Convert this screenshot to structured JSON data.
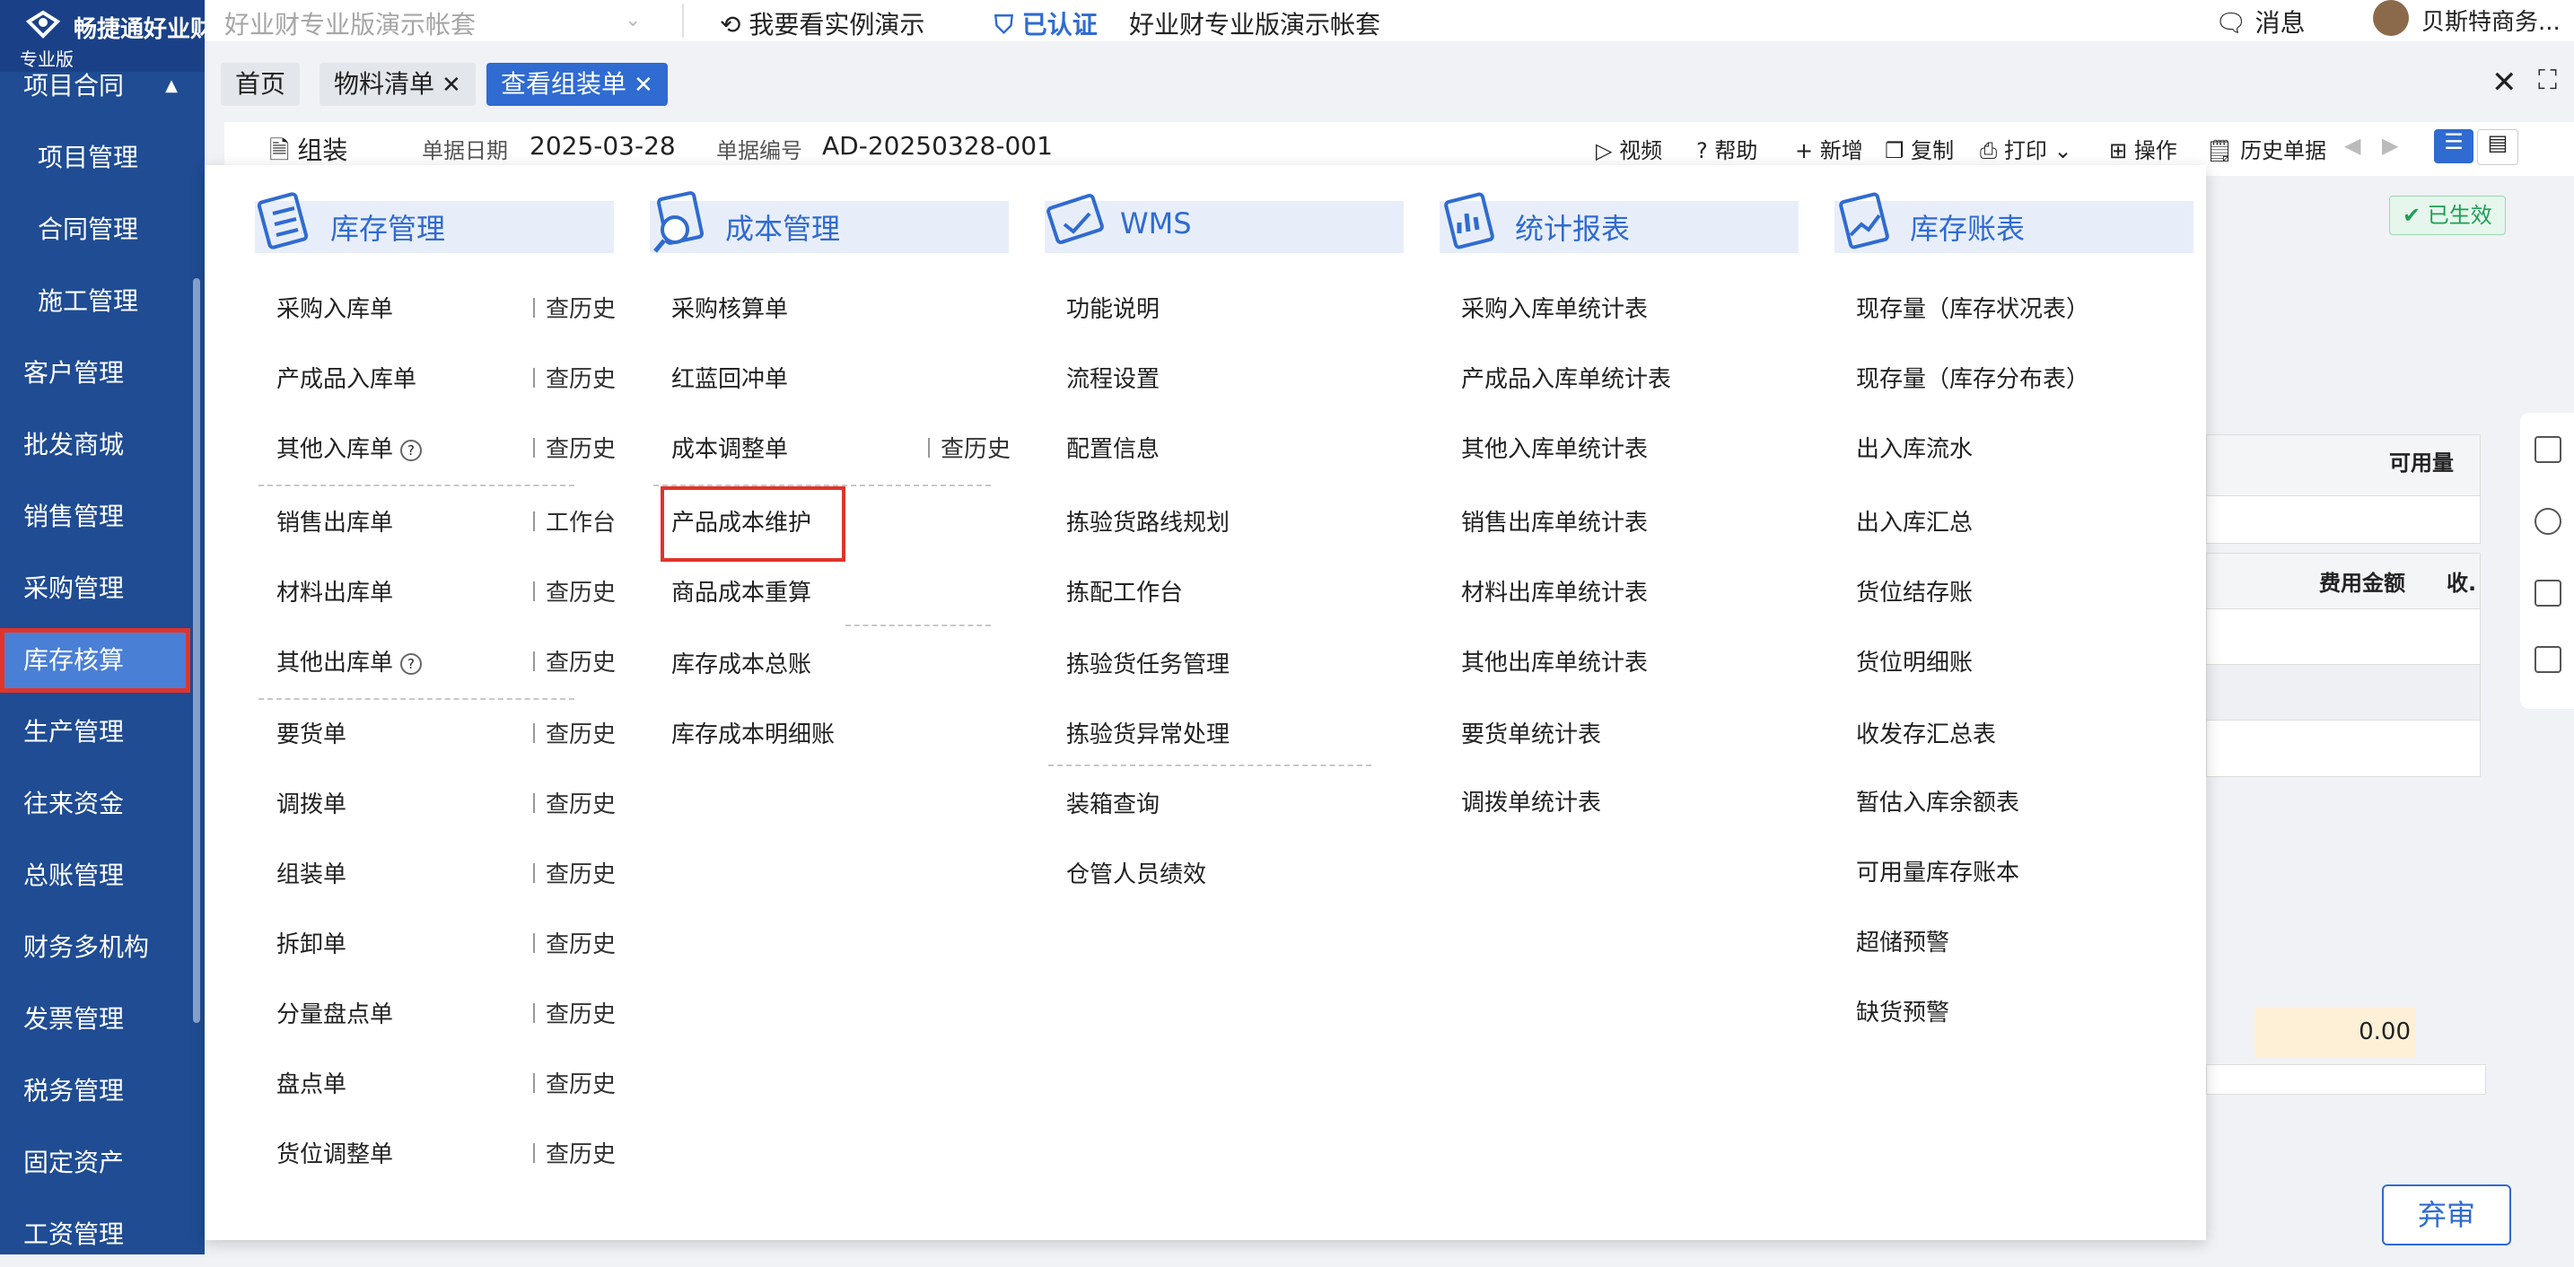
{
  "app": {
    "logo_text": "畅捷通好业财",
    "edition": "专业版"
  },
  "sidebar": {
    "items": [
      {
        "label": "项目合同",
        "kind": "top"
      },
      {
        "label": "项目管理",
        "kind": "sub"
      },
      {
        "label": "合同管理",
        "kind": "sub"
      },
      {
        "label": "施工管理",
        "kind": "sub"
      },
      {
        "label": "客户管理",
        "kind": "top"
      },
      {
        "label": "批发商城",
        "kind": "top"
      },
      {
        "label": "销售管理",
        "kind": "top"
      },
      {
        "label": "采购管理",
        "kind": "top"
      },
      {
        "label": "库存核算",
        "kind": "top",
        "active": true
      },
      {
        "label": "生产管理",
        "kind": "top"
      },
      {
        "label": "往来资金",
        "kind": "top"
      },
      {
        "label": "总账管理",
        "kind": "top"
      },
      {
        "label": "财务多机构",
        "kind": "top"
      },
      {
        "label": "发票管理",
        "kind": "top"
      },
      {
        "label": "税务管理",
        "kind": "top"
      },
      {
        "label": "固定资产",
        "kind": "top"
      },
      {
        "label": "工资管理",
        "kind": "top"
      }
    ]
  },
  "topbar": {
    "account_select": "好业财专业版演示帐套",
    "demo_link": "我要看实例演示",
    "certified": "已认证",
    "account_name": "好业财专业版演示帐套",
    "messages": "消息",
    "user": "贝斯特商务..."
  },
  "tabs": [
    {
      "label": "首页",
      "closable": false
    },
    {
      "label": "物料清单",
      "closable": true
    },
    {
      "label": "查看组装单",
      "closable": true,
      "active": true
    }
  ],
  "toolbar": {
    "doc_type": "组装",
    "date_label": "单据日期",
    "date_value": "2025-03-28",
    "code_label": "单据编号",
    "code_value": "AD-20250328-001",
    "actions": [
      "视频",
      "帮助",
      "新增",
      "复制",
      "打印",
      "操作",
      "历史单据"
    ]
  },
  "background": {
    "status": "已生效",
    "col_available": "可用量",
    "col_fee": "费用金额",
    "col_receipt": "收.",
    "total_amount": "0.00",
    "abandon_button": "弃审"
  },
  "menu": {
    "columns": [
      {
        "title": "库存管理",
        "icon": "inventory-icon",
        "items": [
          {
            "label": "采购入库单",
            "extra": "查历史"
          },
          {
            "label": "产成品入库单",
            "extra": "查历史"
          },
          {
            "label": "其他入库单",
            "extra": "查历史",
            "help": true
          },
          {
            "label": "销售出库单",
            "extra": "工作台"
          },
          {
            "label": "材料出库单",
            "extra": "查历史"
          },
          {
            "label": "其他出库单",
            "extra": "查历史",
            "help": true
          },
          {
            "label": "要货单",
            "extra": "查历史"
          },
          {
            "label": "调拨单",
            "extra": "查历史"
          },
          {
            "label": "组装单",
            "extra": "查历史"
          },
          {
            "label": "拆卸单",
            "extra": "查历史"
          },
          {
            "label": "分量盘点单",
            "extra": "查历史"
          },
          {
            "label": "盘点单",
            "extra": "查历史"
          },
          {
            "label": "货位调整单",
            "extra": "查历史"
          }
        ]
      },
      {
        "title": "成本管理",
        "icon": "cost-icon",
        "items": [
          {
            "label": "采购核算单"
          },
          {
            "label": "红蓝回冲单"
          },
          {
            "label": "成本调整单",
            "extra": "查历史"
          },
          {
            "label": "产品成本维护",
            "highlighted": true
          },
          {
            "label": "商品成本重算"
          },
          {
            "label": "库存成本总账"
          },
          {
            "label": "库存成本明细账"
          }
        ]
      },
      {
        "title": "WMS",
        "icon": "wms-icon",
        "items": [
          {
            "label": "功能说明"
          },
          {
            "label": "流程设置"
          },
          {
            "label": "配置信息"
          },
          {
            "label": "拣验货路线规划"
          },
          {
            "label": "拣配工作台"
          },
          {
            "label": "拣验货任务管理"
          },
          {
            "label": "拣验货异常处理"
          },
          {
            "label": "装箱查询"
          },
          {
            "label": "仓管人员绩效"
          }
        ]
      },
      {
        "title": "统计报表",
        "icon": "report-icon",
        "items": [
          {
            "label": "采购入库单统计表"
          },
          {
            "label": "产成品入库单统计表"
          },
          {
            "label": "其他入库单统计表"
          },
          {
            "label": "销售出库单统计表"
          },
          {
            "label": "材料出库单统计表"
          },
          {
            "label": "其他出库单统计表"
          },
          {
            "label": "要货单统计表"
          },
          {
            "label": "调拨单统计表"
          }
        ]
      },
      {
        "title": "库存账表",
        "icon": "ledger-icon",
        "items": [
          {
            "label": "现存量（库存状况表）"
          },
          {
            "label": "现存量（库存分布表）"
          },
          {
            "label": "出入库流水"
          },
          {
            "label": "出入库汇总"
          },
          {
            "label": "货位结存账"
          },
          {
            "label": "货位明细账"
          },
          {
            "label": "收发存汇总表"
          },
          {
            "label": "暂估入库余额表"
          },
          {
            "label": "可用量库存账本"
          },
          {
            "label": "超储预警"
          },
          {
            "label": "缺货预警"
          }
        ]
      }
    ]
  },
  "colors": {
    "sidebar": "#1f4c93",
    "sidebar_active": "#4a7fd6",
    "accent": "#2f6bd1",
    "highlight_border": "#e0342a",
    "status_green": "#1f9d55"
  }
}
